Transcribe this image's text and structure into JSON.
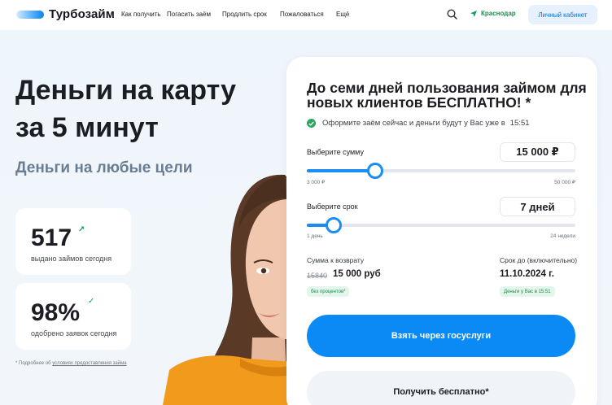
{
  "header": {
    "logo_text": "Турбозайм",
    "nav": [
      "Как получить",
      "Погасить заём",
      "Продлить срок",
      "Пожаловаться",
      "Ещё"
    ],
    "city": "Краснодар",
    "cabinet_label": "Личный кабинет"
  },
  "hero": {
    "title_line1": "Деньги на карту",
    "title_line2": "за 5 минут",
    "subtitle": "Деньги на любые цели"
  },
  "stats": [
    {
      "value": "517",
      "label": "выдано займов сегодня"
    },
    {
      "value": "98%",
      "label": "одобрено заявок сегодня"
    }
  ],
  "footnote": {
    "prefix": "* Подробнее об",
    "link": "условиях предоставления займа"
  },
  "calculator": {
    "title": "До семи дней пользования займом для новых клиентов БЕСПЛАТНО! *",
    "promo_text": "Оформите заём сейчас и деньги будут у Вас уже в",
    "promo_time": "15:51",
    "amount": {
      "label": "Выберите сумму",
      "value": "15 000 ₽",
      "min_label": "3 000 ₽",
      "max_label": "50 000 ₽",
      "min": 3000,
      "max": 50000,
      "current": 15000
    },
    "term": {
      "label": "Выберите срок",
      "value": "7 дней",
      "min_label": "1 день",
      "max_label": "24 недели",
      "level": 0.1
    },
    "return_label": "Сумма к возврату",
    "old_sum": "15840",
    "new_sum": "15 000 руб",
    "no_interest_tag": "без процентов*",
    "term_end_label": "Срок до (включительно)",
    "term_end_date": "11.10.2024 г.",
    "money_tag": "Деньги у Вас в 15:51",
    "primary_button": "Взять через госуслуги",
    "secondary_button": "Получить бесплатно*"
  },
  "colors": {
    "accent": "#0b8af5",
    "green": "#1d9b5a",
    "subtitle_gray": "#6a7d92"
  }
}
